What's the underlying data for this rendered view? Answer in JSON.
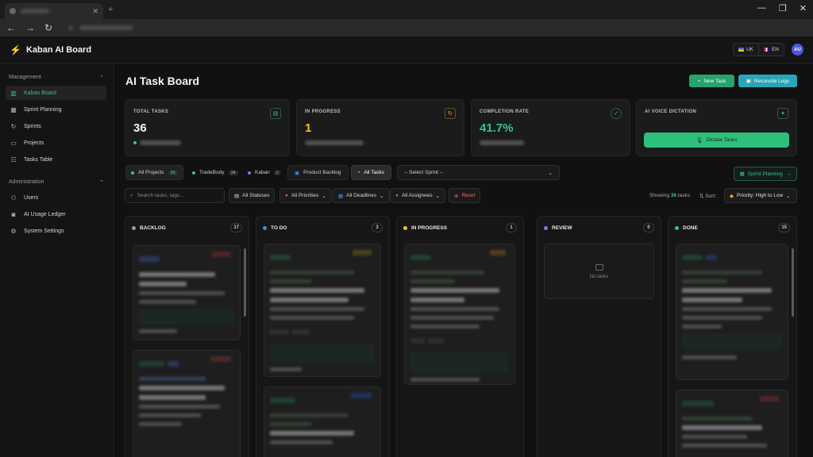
{
  "app": {
    "title": "Kaban AI Board",
    "languages": [
      {
        "code": "UK"
      },
      {
        "code": "EN"
      }
    ],
    "avatar_initials": "AU"
  },
  "sidebar": {
    "sections": [
      {
        "label": "Management",
        "items": [
          {
            "label": "Kaban Board",
            "icon": "board-icon",
            "active": true
          },
          {
            "label": "Sprint Planning",
            "icon": "calendar-icon"
          },
          {
            "label": "Sprints",
            "icon": "refresh-icon"
          },
          {
            "label": "Projects",
            "icon": "folder-icon"
          },
          {
            "label": "Tasks Table",
            "icon": "table-icon"
          }
        ]
      },
      {
        "label": "Administration",
        "items": [
          {
            "label": "Users",
            "icon": "users-icon"
          },
          {
            "label": "AI Usage Ledger",
            "icon": "ai-icon"
          },
          {
            "label": "System Settings",
            "icon": "gear-icon"
          }
        ]
      }
    ]
  },
  "page": {
    "title": "AI Task Board",
    "new_task_label": "New Task",
    "reconcile_label": "Reconcile Logs"
  },
  "stats": [
    {
      "label": "TOTAL TASKS",
      "value": "36",
      "color": "#f2f2f2",
      "icon": "clipboard-icon",
      "icon_color": "#35c48b"
    },
    {
      "label": "IN PROGRESS",
      "value": "1",
      "color": "#f5c518",
      "icon": "refresh-icon",
      "icon_color": "#f5a623"
    },
    {
      "label": "COMPLETION RATE",
      "value": "41.7%",
      "color": "#35c48b",
      "icon": "check-circle-icon",
      "icon_color": "#35c48b"
    },
    {
      "label": "AI VOICE DICTATION",
      "button": "Dictate Tasks",
      "icon": "sparkle-icon",
      "icon_color": "#35c48b"
    }
  ],
  "projects": [
    {
      "label": "All Projects",
      "count": "36",
      "active": true,
      "color": ""
    },
    {
      "label": "TradeBody",
      "count": "34",
      "color": "#35c48b"
    },
    {
      "label": "Kaban",
      "count": "2",
      "color": "#7a7af0"
    }
  ],
  "views": [
    {
      "label": "Product Backlog",
      "icon": "backlog-icon"
    },
    {
      "label": "All Tasks",
      "icon": "box-icon",
      "active": true
    }
  ],
  "sprint_select": "-- Select Sprint --",
  "sprint_planning_label": "Sprint Planning",
  "filters": {
    "search_placeholder": "Search tasks, tags...",
    "statuses": "All Statuses",
    "priorities": "All Priorities",
    "deadlines": "All Deadlines",
    "assignees": "All Assignees",
    "reset": "Reset",
    "showing_prefix": "Showing",
    "showing_count": "36",
    "showing_suffix": "tasks",
    "sort_label": "Sort:",
    "sort_value": "Priority: High to Low"
  },
  "columns": [
    {
      "title": "BACKLOG",
      "count": "17",
      "color": "#9a9a9a"
    },
    {
      "title": "TO DO",
      "count": "3",
      "color": "#3b8ef0"
    },
    {
      "title": "IN PROGRESS",
      "count": "1",
      "color": "#f5c518"
    },
    {
      "title": "REVIEW",
      "count": "0",
      "color": "#9b6cf0",
      "empty_text": "No tasks"
    },
    {
      "title": "DONE",
      "count": "15",
      "color": "#35c48b"
    }
  ]
}
